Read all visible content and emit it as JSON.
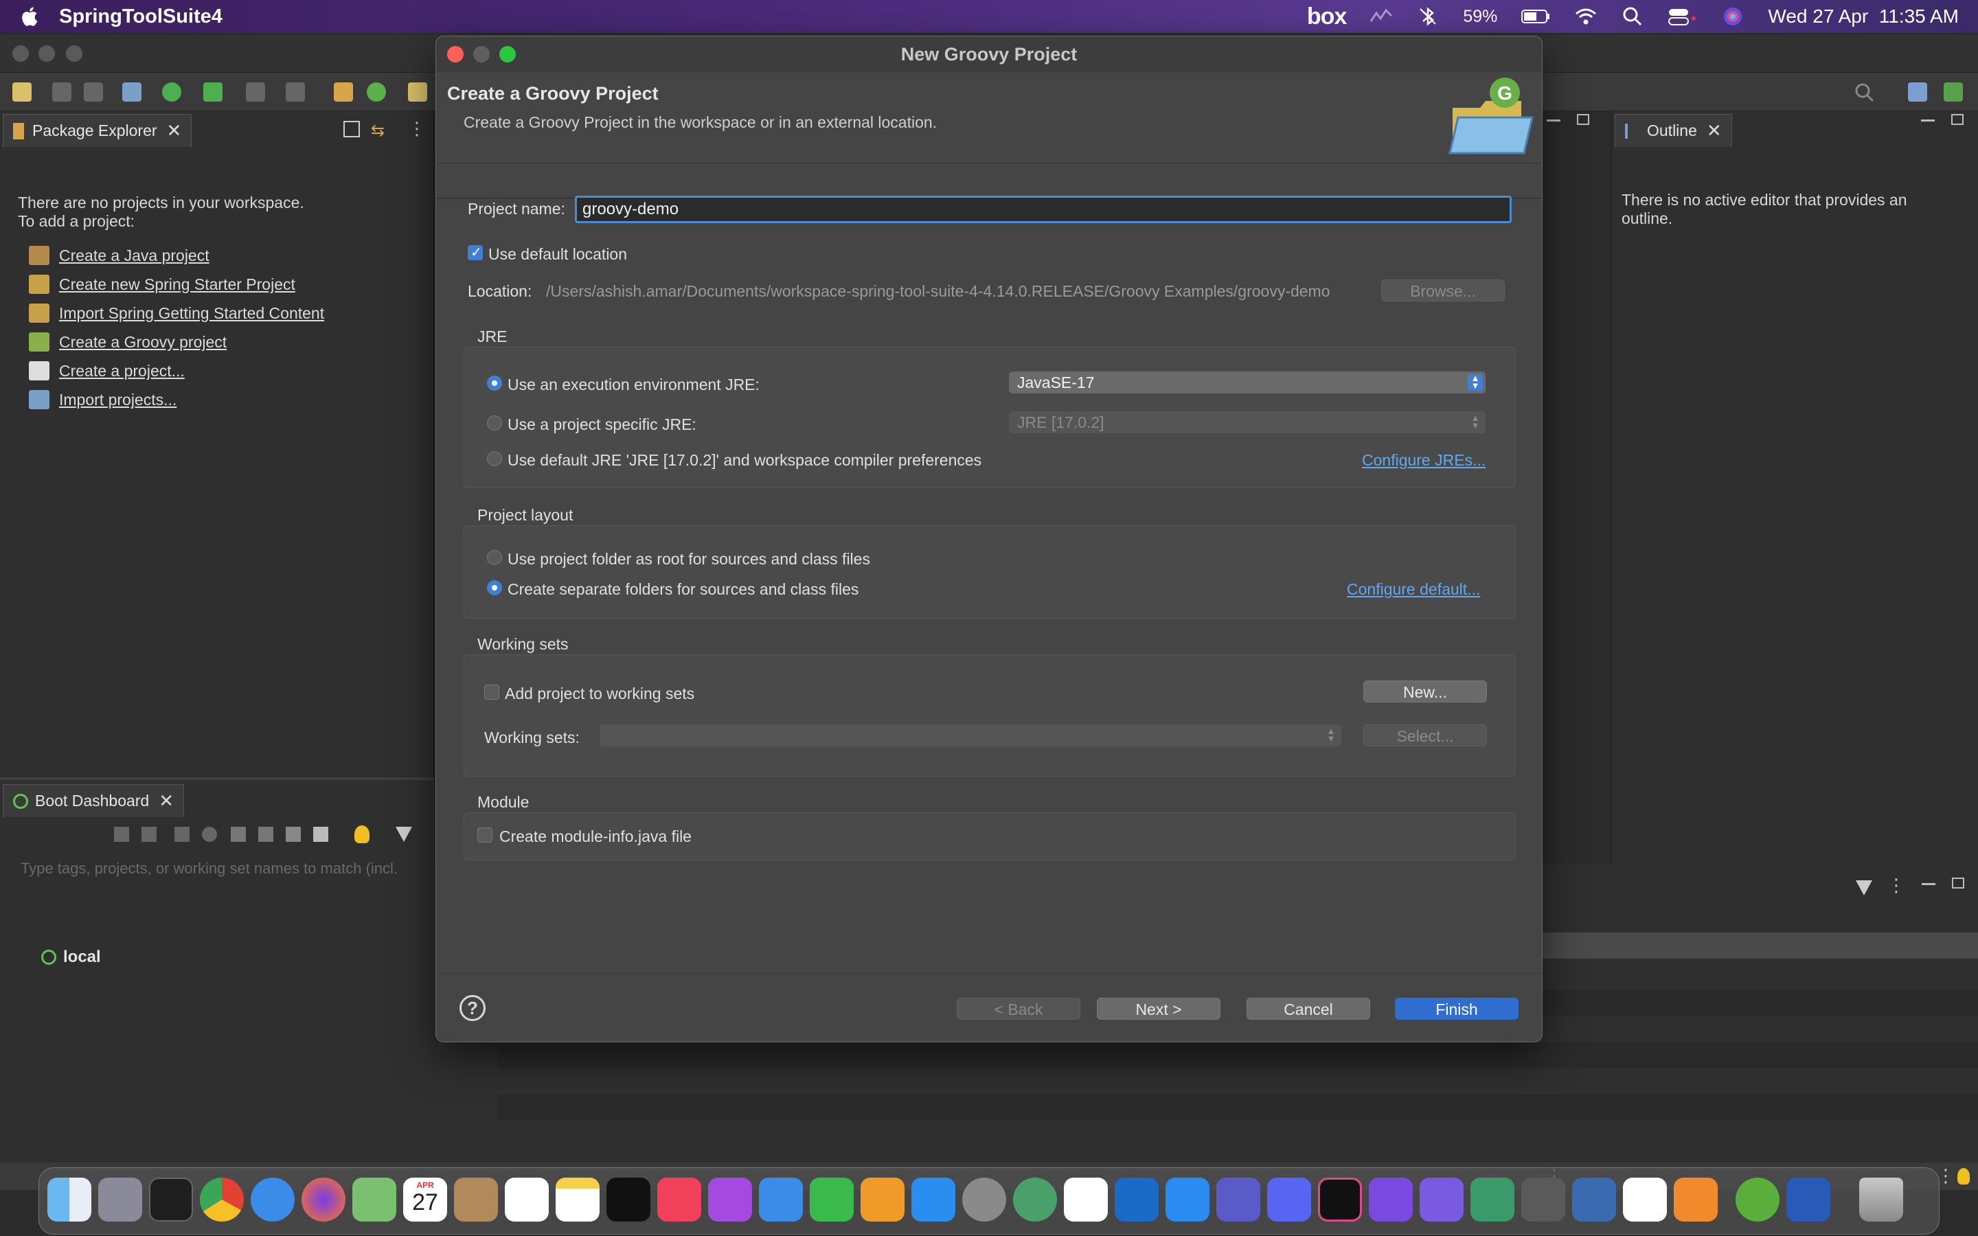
{
  "menubar": {
    "app_name": "SpringToolSuite4",
    "box_label": "box",
    "battery": "59%",
    "datetime": "Wed 27 Apr  11:35 AM"
  },
  "package_explorer": {
    "tab_label": "Package Explorer",
    "message_line1": "There are no projects in your workspace.",
    "message_line2": "To add a project:",
    "links": [
      "Create a Java project",
      "Create new Spring Starter Project",
      "Import Spring Getting Started Content",
      "Create a Groovy project",
      "Create a project...",
      "Import projects..."
    ]
  },
  "boot_dashboard": {
    "tab_label": "Boot Dashboard",
    "filter_placeholder": "Type tags, projects, or working set names to match (incl.",
    "local_label": "local"
  },
  "outline": {
    "tab_label": "Outline",
    "message": "There is no active editor that provides an outline."
  },
  "dialog": {
    "title": "New Groovy Project",
    "header_title": "Create a Groovy Project",
    "header_desc": "Create a Groovy Project in the workspace or in an external location.",
    "project_name_label": "Project name:",
    "project_name_value": "groovy-demo",
    "use_default_location": "Use default location",
    "location_label": "Location:",
    "location_value": "/Users/ashish.amar/Documents/workspace-spring-tool-suite-4-4.14.0.RELEASE/Groovy Examples/groovy-demo",
    "browse_label": "Browse...",
    "jre": {
      "group_label": "JRE",
      "option_exec_env": "Use an execution environment JRE:",
      "exec_env_value": "JavaSE-17",
      "option_project_specific": "Use a project specific JRE:",
      "project_specific_value": "JRE [17.0.2]",
      "option_default": "Use default JRE 'JRE [17.0.2]' and workspace compiler preferences",
      "configure_link": "Configure JREs..."
    },
    "layout": {
      "group_label": "Project layout",
      "option_root": "Use project folder as root for sources and class files",
      "option_separate": "Create separate folders for sources and class files",
      "configure_link": "Configure default..."
    },
    "working_sets": {
      "group_label": "Working sets",
      "add_label": "Add project to working sets",
      "new_button": "New...",
      "sets_label": "Working sets:",
      "select_button": "Select..."
    },
    "module": {
      "group_label": "Module",
      "create_label": "Create module-info.java file"
    },
    "buttons": {
      "back": "< Back",
      "next": "Next >",
      "cancel": "Cancel",
      "finish": "Finish",
      "help": "?"
    }
  },
  "dock": {
    "calendar_month": "APR",
    "calendar_day": "27"
  },
  "colors": {
    "accent": "#2f6ed0",
    "link": "#5fa9ef",
    "dialog_bg": "#454545"
  }
}
